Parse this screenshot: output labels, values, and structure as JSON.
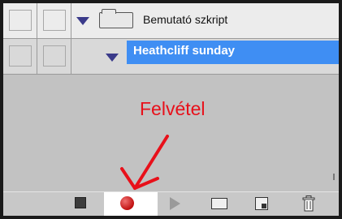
{
  "panel": {
    "rows": [
      {
        "label": "Bemutató szkript",
        "type": "set",
        "expanded": true
      },
      {
        "label": "Heathcliff sunday",
        "type": "action",
        "expanded": true,
        "selected": true
      }
    ]
  },
  "annotation": {
    "text": "Felvétel",
    "color": "#e8101a"
  },
  "toolbar": {
    "buttons": [
      {
        "icon": "stop-icon",
        "active": false
      },
      {
        "icon": "record-icon",
        "active": true
      },
      {
        "icon": "play-icon",
        "active": false
      },
      {
        "icon": "new-set-icon",
        "active": false
      },
      {
        "icon": "new-action-icon",
        "active": false
      },
      {
        "icon": "trash-icon",
        "active": false
      }
    ]
  },
  "colors": {
    "selection": "#3f8ef3",
    "annotation": "#e8101a",
    "panel_bg": "#c2c2c2"
  }
}
